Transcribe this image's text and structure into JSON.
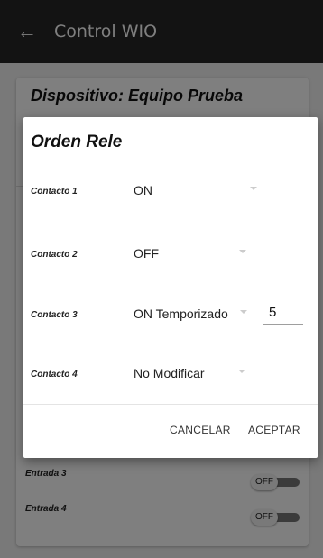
{
  "appbar": {
    "back_icon": "arrow-left-icon",
    "title": "Control WIO"
  },
  "card": {
    "title": "Dispositivo: Equipo Prueba"
  },
  "entradas": [
    {
      "label": "Entrada 3",
      "state": "OFF"
    },
    {
      "label": "Entrada 4",
      "state": "OFF"
    }
  ],
  "dialog": {
    "title": "Orden Rele",
    "rows": [
      {
        "label": "Contacto 1",
        "value": "ON"
      },
      {
        "label": "Contacto 2",
        "value": "OFF"
      },
      {
        "label": "Contacto 3",
        "value": "ON Temporizado",
        "timer_value": "5"
      },
      {
        "label": "Contacto 4",
        "value": "No Modificar"
      }
    ],
    "cancel_label": "CANCELAR",
    "accept_label": "ACEPTAR"
  }
}
